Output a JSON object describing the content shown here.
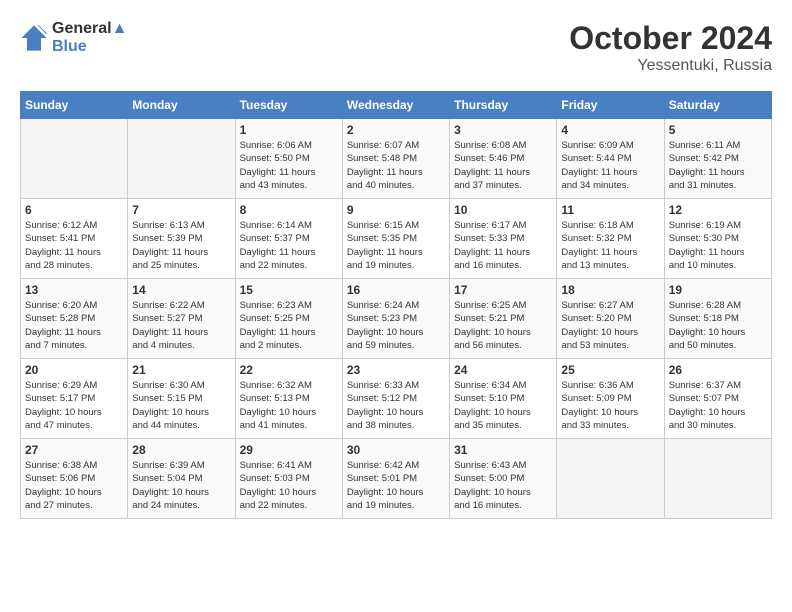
{
  "header": {
    "logo_line1": "General",
    "logo_line2": "Blue",
    "title": "October 2024",
    "location": "Yessentuki, Russia"
  },
  "days_of_week": [
    "Sunday",
    "Monday",
    "Tuesday",
    "Wednesday",
    "Thursday",
    "Friday",
    "Saturday"
  ],
  "weeks": [
    [
      {
        "num": "",
        "info": ""
      },
      {
        "num": "",
        "info": ""
      },
      {
        "num": "1",
        "info": "Sunrise: 6:06 AM\nSunset: 5:50 PM\nDaylight: 11 hours\nand 43 minutes."
      },
      {
        "num": "2",
        "info": "Sunrise: 6:07 AM\nSunset: 5:48 PM\nDaylight: 11 hours\nand 40 minutes."
      },
      {
        "num": "3",
        "info": "Sunrise: 6:08 AM\nSunset: 5:46 PM\nDaylight: 11 hours\nand 37 minutes."
      },
      {
        "num": "4",
        "info": "Sunrise: 6:09 AM\nSunset: 5:44 PM\nDaylight: 11 hours\nand 34 minutes."
      },
      {
        "num": "5",
        "info": "Sunrise: 6:11 AM\nSunset: 5:42 PM\nDaylight: 11 hours\nand 31 minutes."
      }
    ],
    [
      {
        "num": "6",
        "info": "Sunrise: 6:12 AM\nSunset: 5:41 PM\nDaylight: 11 hours\nand 28 minutes."
      },
      {
        "num": "7",
        "info": "Sunrise: 6:13 AM\nSunset: 5:39 PM\nDaylight: 11 hours\nand 25 minutes."
      },
      {
        "num": "8",
        "info": "Sunrise: 6:14 AM\nSunset: 5:37 PM\nDaylight: 11 hours\nand 22 minutes."
      },
      {
        "num": "9",
        "info": "Sunrise: 6:15 AM\nSunset: 5:35 PM\nDaylight: 11 hours\nand 19 minutes."
      },
      {
        "num": "10",
        "info": "Sunrise: 6:17 AM\nSunset: 5:33 PM\nDaylight: 11 hours\nand 16 minutes."
      },
      {
        "num": "11",
        "info": "Sunrise: 6:18 AM\nSunset: 5:32 PM\nDaylight: 11 hours\nand 13 minutes."
      },
      {
        "num": "12",
        "info": "Sunrise: 6:19 AM\nSunset: 5:30 PM\nDaylight: 11 hours\nand 10 minutes."
      }
    ],
    [
      {
        "num": "13",
        "info": "Sunrise: 6:20 AM\nSunset: 5:28 PM\nDaylight: 11 hours\nand 7 minutes."
      },
      {
        "num": "14",
        "info": "Sunrise: 6:22 AM\nSunset: 5:27 PM\nDaylight: 11 hours\nand 4 minutes."
      },
      {
        "num": "15",
        "info": "Sunrise: 6:23 AM\nSunset: 5:25 PM\nDaylight: 11 hours\nand 2 minutes."
      },
      {
        "num": "16",
        "info": "Sunrise: 6:24 AM\nSunset: 5:23 PM\nDaylight: 10 hours\nand 59 minutes."
      },
      {
        "num": "17",
        "info": "Sunrise: 6:25 AM\nSunset: 5:21 PM\nDaylight: 10 hours\nand 56 minutes."
      },
      {
        "num": "18",
        "info": "Sunrise: 6:27 AM\nSunset: 5:20 PM\nDaylight: 10 hours\nand 53 minutes."
      },
      {
        "num": "19",
        "info": "Sunrise: 6:28 AM\nSunset: 5:18 PM\nDaylight: 10 hours\nand 50 minutes."
      }
    ],
    [
      {
        "num": "20",
        "info": "Sunrise: 6:29 AM\nSunset: 5:17 PM\nDaylight: 10 hours\nand 47 minutes."
      },
      {
        "num": "21",
        "info": "Sunrise: 6:30 AM\nSunset: 5:15 PM\nDaylight: 10 hours\nand 44 minutes."
      },
      {
        "num": "22",
        "info": "Sunrise: 6:32 AM\nSunset: 5:13 PM\nDaylight: 10 hours\nand 41 minutes."
      },
      {
        "num": "23",
        "info": "Sunrise: 6:33 AM\nSunset: 5:12 PM\nDaylight: 10 hours\nand 38 minutes."
      },
      {
        "num": "24",
        "info": "Sunrise: 6:34 AM\nSunset: 5:10 PM\nDaylight: 10 hours\nand 35 minutes."
      },
      {
        "num": "25",
        "info": "Sunrise: 6:36 AM\nSunset: 5:09 PM\nDaylight: 10 hours\nand 33 minutes."
      },
      {
        "num": "26",
        "info": "Sunrise: 6:37 AM\nSunset: 5:07 PM\nDaylight: 10 hours\nand 30 minutes."
      }
    ],
    [
      {
        "num": "27",
        "info": "Sunrise: 6:38 AM\nSunset: 5:06 PM\nDaylight: 10 hours\nand 27 minutes."
      },
      {
        "num": "28",
        "info": "Sunrise: 6:39 AM\nSunset: 5:04 PM\nDaylight: 10 hours\nand 24 minutes."
      },
      {
        "num": "29",
        "info": "Sunrise: 6:41 AM\nSunset: 5:03 PM\nDaylight: 10 hours\nand 22 minutes."
      },
      {
        "num": "30",
        "info": "Sunrise: 6:42 AM\nSunset: 5:01 PM\nDaylight: 10 hours\nand 19 minutes."
      },
      {
        "num": "31",
        "info": "Sunrise: 6:43 AM\nSunset: 5:00 PM\nDaylight: 10 hours\nand 16 minutes."
      },
      {
        "num": "",
        "info": ""
      },
      {
        "num": "",
        "info": ""
      }
    ]
  ]
}
